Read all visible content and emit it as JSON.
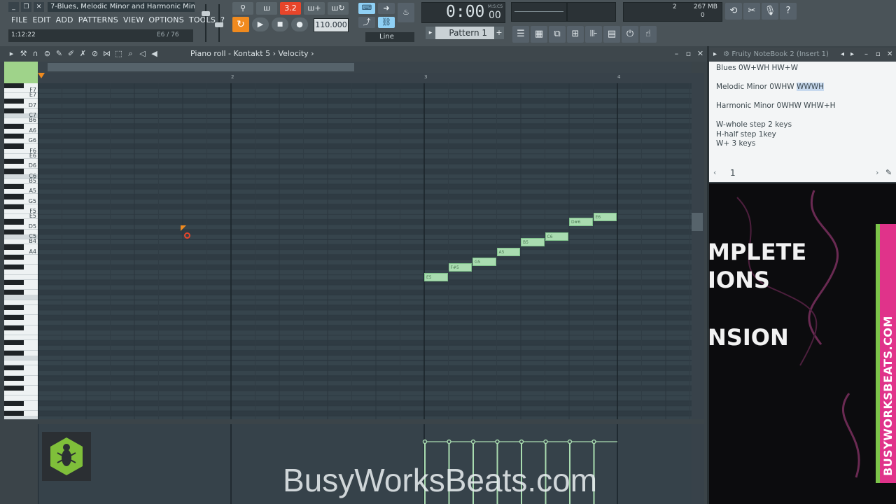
{
  "window": {
    "title": "7-Blues, Melodic Minor and Harmonic Min...",
    "time_display": "0:00",
    "time_sub": "00",
    "time_mode": "M:S:CS",
    "song_pos": "1:12:22",
    "hint_note": "E6 / 76",
    "tempo": "110.000",
    "pattern": "Pattern 1",
    "snap": "Line",
    "memory": "267 MB",
    "cpu_num": "2",
    "poly": "0"
  },
  "menu": [
    "FILE",
    "EDIT",
    "ADD",
    "PATTERNS",
    "VIEW",
    "OPTIONS",
    "TOOLS",
    "?"
  ],
  "piano_roll": {
    "breadcrumb": [
      "Piano roll",
      "Kontakt 5",
      "Velocity"
    ],
    "bar_numbers": [
      "2",
      "3",
      "4"
    ],
    "key_labels": [
      "F7",
      "E7",
      "D7",
      "C7",
      "B6",
      "A6",
      "G6",
      "F6",
      "E6",
      "D6",
      "C6",
      "B5",
      "A5",
      "G5",
      "F5",
      "E5",
      "D5",
      "C5",
      "B4",
      "A4"
    ],
    "notes": [
      {
        "label": "E5",
        "step": 16,
        "pitch": 64
      },
      {
        "label": "F#5",
        "step": 17,
        "pitch": 66
      },
      {
        "label": "G5",
        "step": 18,
        "pitch": 67
      },
      {
        "label": "A5",
        "step": 19,
        "pitch": 69
      },
      {
        "label": "B5",
        "step": 20,
        "pitch": 71
      },
      {
        "label": "C6",
        "step": 21,
        "pitch": 72
      },
      {
        "label": "D#6",
        "step": 22,
        "pitch": 75
      },
      {
        "label": "E6",
        "step": 23,
        "pitch": 76
      }
    ]
  },
  "notebook": {
    "title": "Fruity NoteBook 2 (Insert 1)",
    "lines": [
      {
        "text": "Blues  0W+WH HW+W",
        "highlight": ""
      },
      {
        "text": "",
        "highlight": ""
      },
      {
        "text": "Melodic Minor 0WHW ",
        "highlight": "WWWH"
      },
      {
        "text": "",
        "highlight": ""
      },
      {
        "text": "Harmonic Minor 0WHW WHW+H",
        "highlight": ""
      },
      {
        "text": "",
        "highlight": ""
      },
      {
        "text": "W-whole step 2 keys",
        "highlight": ""
      },
      {
        "text": "H-half step 1key",
        "highlight": ""
      },
      {
        "text": "W+ 3 keys",
        "highlight": ""
      }
    ],
    "page": "1"
  },
  "promo": {
    "lines": [
      "MPLETE",
      "IONS",
      "NSION"
    ],
    "box_text": "BUSYWORKSBEATS.COM"
  },
  "watermark": "BusyWorksBeats.com",
  "colors": {
    "note": "#a9dcb0",
    "accent": "#e8452a",
    "grid": "#34434c"
  }
}
